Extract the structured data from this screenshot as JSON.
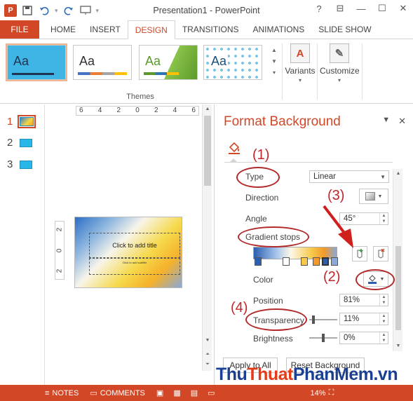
{
  "app": {
    "title": "Presentation1 - PowerPoint",
    "logo": "P",
    "window_controls": [
      "?",
      "⊟",
      "—",
      "☐",
      "✕"
    ]
  },
  "qat": {
    "icons": [
      "powerpoint-logo",
      "save-icon",
      "undo-icon",
      "redo-icon",
      "present-icon",
      "customize-qat-icon"
    ]
  },
  "tabs": [
    {
      "label": "FILE",
      "active": false
    },
    {
      "label": "HOME",
      "active": false
    },
    {
      "label": "INSERT",
      "active": false
    },
    {
      "label": "DESIGN",
      "active": true
    },
    {
      "label": "TRANSITIONS",
      "active": false
    },
    {
      "label": "ANIMATIONS",
      "active": false
    },
    {
      "label": "SLIDE SHOW",
      "active": false
    }
  ],
  "ribbon": {
    "themes_label": "Themes",
    "theme_sample": "Aa",
    "variants_label": "Variants",
    "customize_label": "Customize"
  },
  "thumbnails": [
    {
      "num": "1",
      "active": true
    },
    {
      "num": "2",
      "active": false
    },
    {
      "num": "3",
      "active": false
    }
  ],
  "ruler": {
    "h": [
      "6",
      "4",
      "2",
      "0",
      "2",
      "4",
      "6"
    ],
    "v": [
      "2",
      "0",
      "2"
    ]
  },
  "slide": {
    "title_placeholder": "Click to add title",
    "subtitle_placeholder": "Click to add subtitle"
  },
  "pane": {
    "title": "Format Background",
    "type_label": "Type",
    "type_value": "Linear",
    "direction_label": "Direction",
    "angle_label": "Angle",
    "angle_value": "45°",
    "gradient_stops_label": "Gradient stops",
    "color_label": "Color",
    "position_label": "Position",
    "position_value": "81%",
    "transparency_label": "Transparency",
    "transparency_value": "11%",
    "brightness_label": "Brightness",
    "brightness_value": "0%",
    "apply_all": "Apply to All",
    "reset": "Reset Background"
  },
  "annotations": [
    "(1)",
    "(2)",
    "(3)",
    "(4)"
  ],
  "status": {
    "notes": "NOTES",
    "comments": "COMMENTS",
    "zoom": "14%"
  },
  "watermark": {
    "part1": "Thu",
    "part2": "Thuat",
    "part3": "PhanMem",
    "part4": ".vn"
  },
  "colors": {
    "accent": "#d24726",
    "annotation": "#c0262a"
  }
}
